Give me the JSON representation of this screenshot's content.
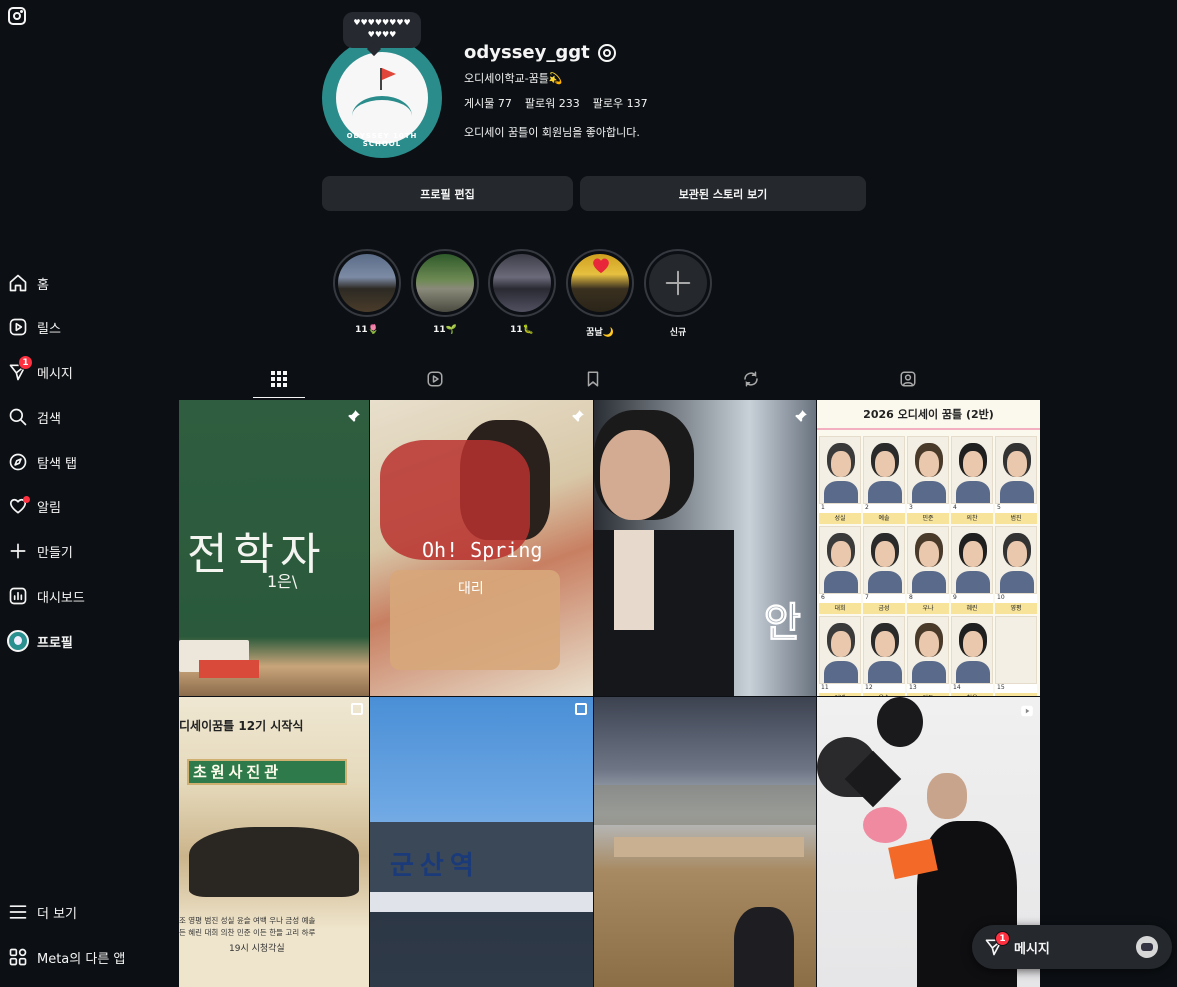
{
  "sidebar": {
    "items": [
      {
        "label": "홈",
        "icon": "home-icon"
      },
      {
        "label": "릴스",
        "icon": "reels-icon"
      },
      {
        "label": "메시지",
        "icon": "messages-icon",
        "badge": "1"
      },
      {
        "label": "검색",
        "icon": "search-icon"
      },
      {
        "label": "탐색 탭",
        "icon": "compass-icon"
      },
      {
        "label": "알림",
        "icon": "heart-icon"
      },
      {
        "label": "만들기",
        "icon": "plus-icon"
      },
      {
        "label": "대시보드",
        "icon": "dashboard-icon"
      },
      {
        "label": "프로필",
        "icon": "profile-avatar"
      }
    ],
    "more_label": "더 보기",
    "meta_label": "Meta의 다른 앱"
  },
  "profile": {
    "note": "♥♥♥♥♥♥♥♥ ♥♥♥♥",
    "avatar_text": "ODYSSEY 10TH SCHOOL",
    "username": "odyssey_ggt",
    "fullname": "오디세이학교-꿈틀💫",
    "stats": {
      "posts": "게시물 77",
      "followers": "팔로워 233",
      "following": "팔로우 137"
    },
    "bio": "오디세이 꿈틀이 회원님을 좋아합니다."
  },
  "buttons": {
    "edit_profile": "프로필 편집",
    "archived_stories": "보관된 스토리 보기"
  },
  "highlights": [
    {
      "label": "11🌷"
    },
    {
      "label": "11🌱"
    },
    {
      "label": "11🐛"
    },
    {
      "label": "꿈날🌙"
    },
    {
      "label": "신규"
    }
  ],
  "tabs": [
    "posts-tab",
    "reels-tab",
    "saved-tab",
    "reposts-tab",
    "tagged-tab"
  ],
  "posts": {
    "p1_text": "전학자",
    "p1_sub": "1은\\",
    "p2_text": "Oh! Spring",
    "p2_sub": "대리",
    "p4_title": "2026 오디세이 꿈틀 (2반)",
    "p4_names_row1": [
      "성실",
      "예솔",
      "민준",
      "의찬",
      "범진"
    ],
    "p4_names_row2": [
      "대희",
      "금성",
      "우나",
      "혜린",
      "영평"
    ],
    "p4_names_row3": [
      "여백",
      "윤슬",
      "이든",
      "청운",
      ""
    ],
    "p5_title": "디세이꿈틀 12기 시작식",
    "p5_sign": "초원사진관",
    "p5_line1": "조 영평 범진  성실 윤슬 여백  우나 금성 예솔",
    "p5_line2": "든 혜린 대희  의찬 민준 이든  한들 고리 하루",
    "p5_time": "19시 시청각실",
    "p6_text": "군산역"
  },
  "chat": {
    "label": "메시지",
    "badge": "1"
  }
}
